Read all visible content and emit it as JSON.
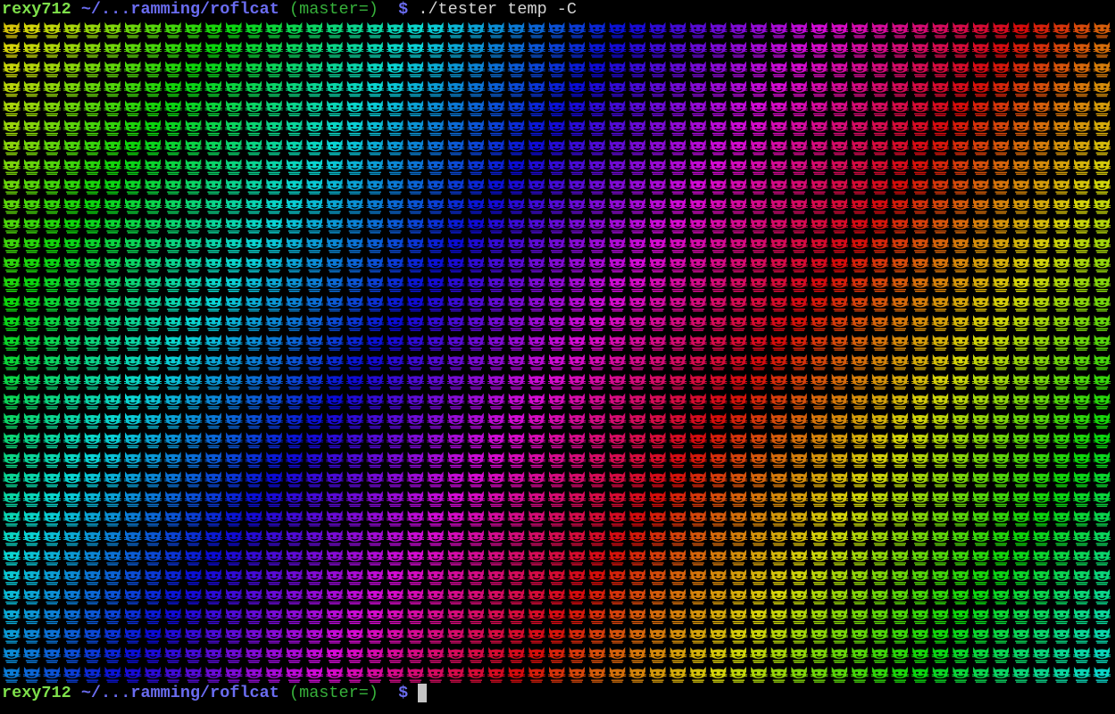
{
  "prompt_top": {
    "user": "rexy712",
    "path": "~/...ramming/roflcat",
    "git": "(master=)",
    "dollar": "$",
    "command": "./tester temp -C"
  },
  "prompt_bottom": {
    "user": "rexy712",
    "path": "~/...ramming/roflcat",
    "git": "(master=)",
    "dollar": "$",
    "command": ""
  },
  "output": {
    "glyph": "cat-face-icon",
    "columns": 55,
    "rows": 34,
    "style": "rainbow-gradient"
  },
  "colors": {
    "background": "#000000",
    "user": "#7ee04a",
    "path": "#6a6cf0",
    "git": "#36b03a",
    "cursor": "#c4c4c4"
  }
}
